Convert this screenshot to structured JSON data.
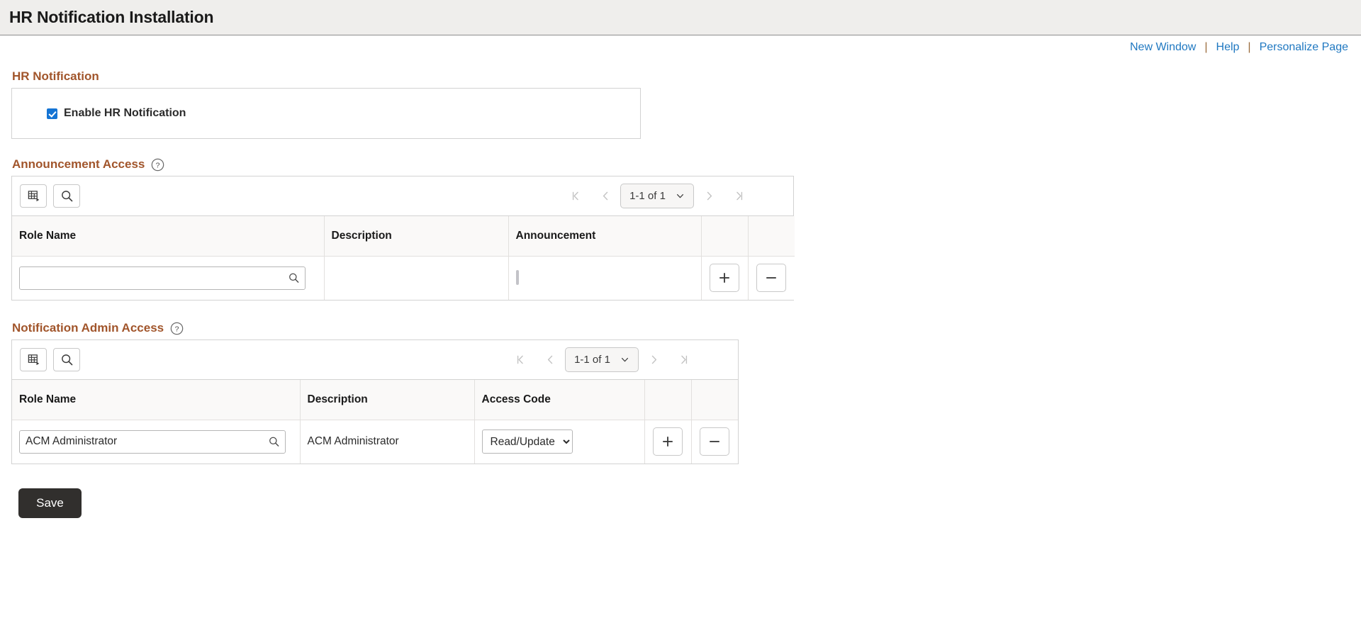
{
  "header": {
    "title": "HR Notification Installation"
  },
  "top_links": [
    {
      "label": "New Window",
      "name": "new-window-link"
    },
    {
      "label": "Help",
      "name": "help-link"
    },
    {
      "label": "Personalize Page",
      "name": "personalize-page-link"
    }
  ],
  "link_separator": "|",
  "hr_notification": {
    "section_title": "HR Notification",
    "checkbox_label": "Enable HR Notification",
    "checkbox_checked": true
  },
  "announcement_access": {
    "section_title": "Announcement Access",
    "help_icon": "help-circle-icon",
    "toolbar": {
      "personalize_icon": "grid-personalize-icon",
      "find_icon": "search-icon"
    },
    "pager": {
      "first_icon": "first-page-icon",
      "prev_icon": "previous-page-icon",
      "range_label": "1-1 of 1",
      "chevron_icon": "chevron-down-icon",
      "next_icon": "next-page-icon",
      "last_icon": "last-page-icon"
    },
    "columns": [
      "Role Name",
      "Description",
      "Announcement",
      "",
      ""
    ],
    "rows": [
      {
        "role_name": "",
        "role_name_placeholder": "",
        "description": "",
        "announcement_checked": false,
        "add_label": "+",
        "remove_label": "–"
      }
    ]
  },
  "notification_admin_access": {
    "section_title": "Notification Admin Access",
    "help_icon": "help-circle-icon",
    "toolbar": {
      "personalize_icon": "grid-personalize-icon",
      "find_icon": "search-icon"
    },
    "pager": {
      "first_icon": "first-page-icon",
      "prev_icon": "previous-page-icon",
      "range_label": "1-1 of 1",
      "chevron_icon": "chevron-down-icon",
      "next_icon": "next-page-icon",
      "last_icon": "last-page-icon"
    },
    "columns": [
      "Role Name",
      "Description",
      "Access Code",
      "",
      ""
    ],
    "rows": [
      {
        "role_name": "ACM Administrator",
        "description": "ACM Administrator",
        "access_code": "Read/Update",
        "access_code_options": [
          "Read/Update"
        ],
        "add_label": "+",
        "remove_label": "–"
      }
    ]
  },
  "footer": {
    "save_label": "Save"
  },
  "colors": {
    "section_heading": "#a1552b",
    "link": "#1f78c1",
    "header_bg": "#efeeec",
    "checkbox_accent": "#1474d4",
    "save_bg": "#312f2d"
  }
}
